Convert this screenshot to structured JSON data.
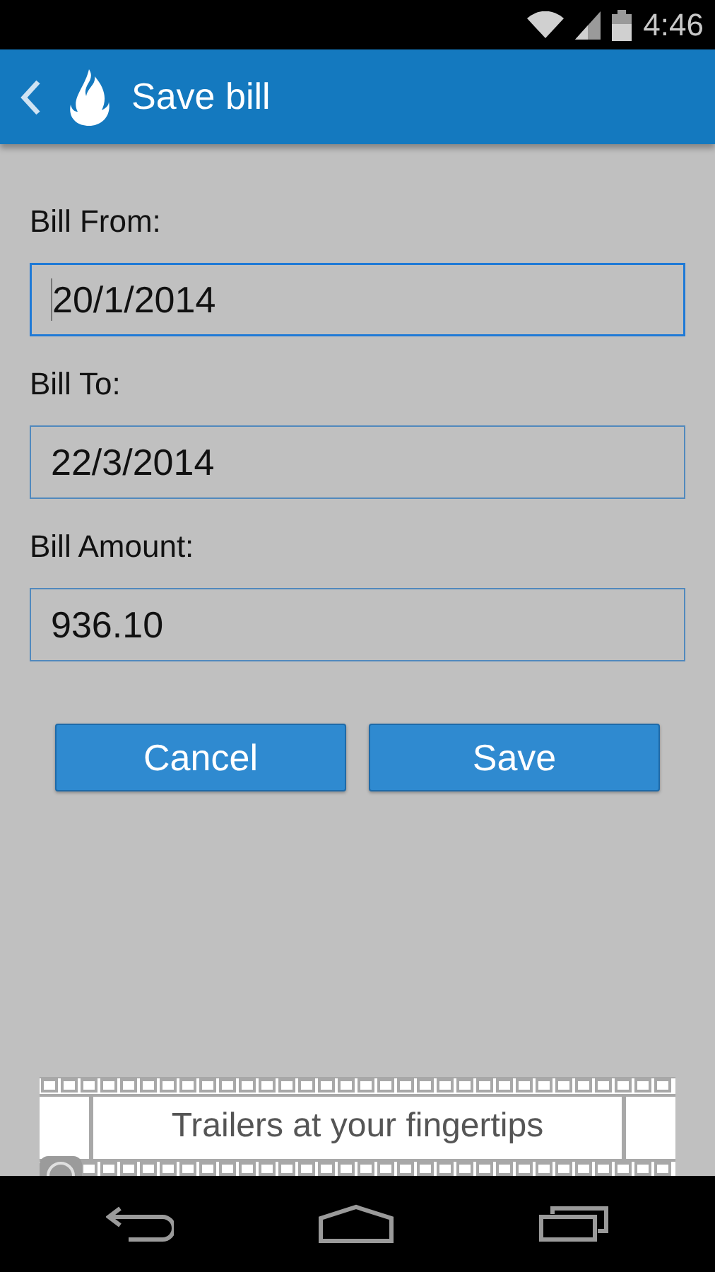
{
  "status_bar": {
    "time": "4:46"
  },
  "app_bar": {
    "title": "Save bill"
  },
  "fields": [
    {
      "label": "Bill From:",
      "value": "20/1/2014",
      "focused": true
    },
    {
      "label": "Bill To:",
      "value": "22/3/2014",
      "focused": false
    },
    {
      "label": "Bill Amount:",
      "value": "936.10",
      "focused": false
    }
  ],
  "buttons": [
    "Cancel",
    "Save"
  ],
  "ad": {
    "text": "Trailers at your fingertips"
  }
}
